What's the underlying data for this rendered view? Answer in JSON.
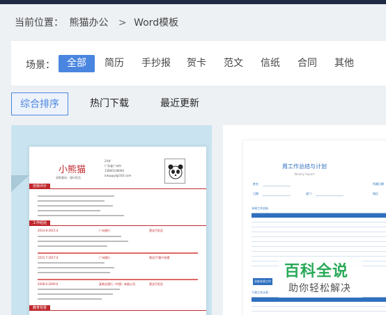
{
  "breadcrumb": {
    "prefix": "当前位置：",
    "home": "熊猫办公",
    "separator": ">",
    "current": "Word模板"
  },
  "filters": {
    "label": "场景：",
    "items": [
      "全部",
      "简历",
      "手抄报",
      "贺卡",
      "范文",
      "信纸",
      "合同",
      "其他"
    ],
    "active_index": 0
  },
  "sort_tabs": {
    "items": [
      "综合排序",
      "热门下载",
      "最近更新"
    ],
    "active_index": 0
  },
  "cards": [
    {
      "name": "小熊猫",
      "subtitle": "求职意向：银行柜员",
      "info": [
        "24岁",
        "广东省广州市",
        "13800138000",
        "lukuppyl@163.com"
      ],
      "sections": [
        "自我评价",
        "工作经验",
        "教育背景"
      ],
      "jobs": [
        {
          "dates": "2014.8-2015.4",
          "company": "广州银行",
          "role": "营业厅柜员"
        },
        {
          "dates": "2015.7-2017.4",
          "company": "广州银行",
          "role": "营业厅/客户经理"
        },
        {
          "dates": "2008.6-2009.6",
          "company": "某商业银行（中国）有限公司",
          "role": "营业厅柜员"
        }
      ]
    },
    {
      "title": "周工作总结与计划",
      "subtitle": "Weekly Report",
      "fields": [
        "姓名",
        "部门",
        "所属日期",
        "日期",
        "岗位"
      ],
      "sections": [
        "本周工作总结",
        "下周工作计划"
      ],
      "side_note": "总结本周工作"
    }
  ],
  "watermark": {
    "title": "百科全说",
    "subtitle": "助你轻松解决"
  },
  "colors": {
    "accent": "#4a86e0",
    "page_bg": "#eef1f4",
    "resume_red": "#c0272d",
    "report_blue": "#2f6fbf",
    "watermark_green": "#27a957"
  }
}
